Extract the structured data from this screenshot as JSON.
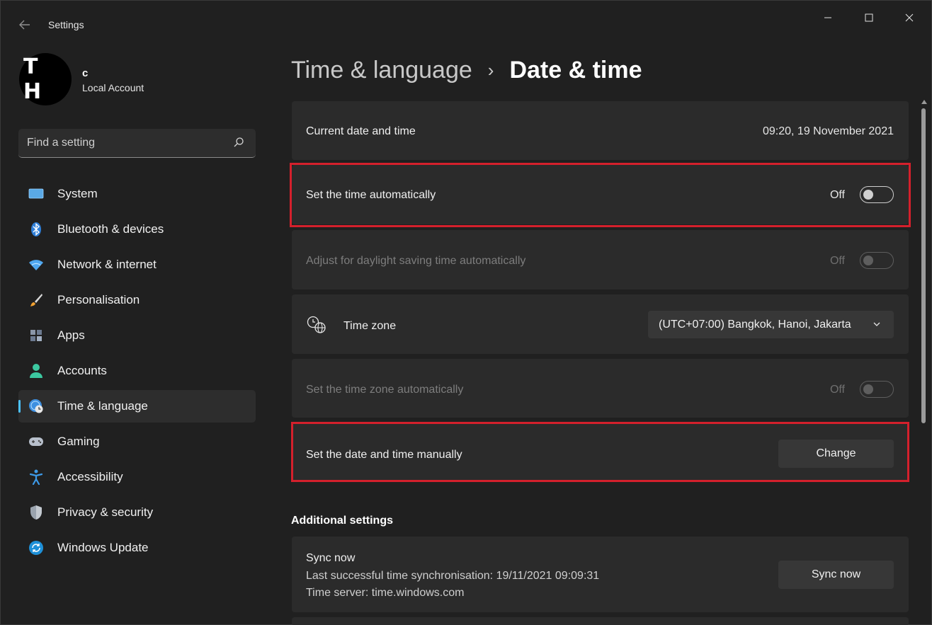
{
  "window": {
    "title": "Settings"
  },
  "profile": {
    "initials": "T H",
    "name": "c",
    "account_type": "Local Account"
  },
  "search": {
    "placeholder": "Find a setting"
  },
  "nav": {
    "items": [
      {
        "label": "System",
        "icon": "monitor-icon"
      },
      {
        "label": "Bluetooth & devices",
        "icon": "bluetooth-icon"
      },
      {
        "label": "Network & internet",
        "icon": "wifi-icon"
      },
      {
        "label": "Personalisation",
        "icon": "brush-icon"
      },
      {
        "label": "Apps",
        "icon": "apps-icon"
      },
      {
        "label": "Accounts",
        "icon": "person-icon"
      },
      {
        "label": "Time & language",
        "icon": "globe-clock-icon",
        "active": true
      },
      {
        "label": "Gaming",
        "icon": "gamepad-icon"
      },
      {
        "label": "Accessibility",
        "icon": "accessibility-icon"
      },
      {
        "label": "Privacy & security",
        "icon": "shield-icon"
      },
      {
        "label": "Windows Update",
        "icon": "update-icon"
      }
    ]
  },
  "header": {
    "parent": "Time & language",
    "separator": "›",
    "current": "Date & time"
  },
  "settings": {
    "current_datetime": {
      "label": "Current date and time",
      "value": "09:20, 19 November 2021"
    },
    "set_time_auto": {
      "label": "Set the time automatically",
      "state": "Off"
    },
    "daylight_saving": {
      "label": "Adjust for daylight saving time automatically",
      "state": "Off"
    },
    "time_zone": {
      "label": "Time zone",
      "value": "(UTC+07:00) Bangkok, Hanoi, Jakarta"
    },
    "time_zone_auto": {
      "label": "Set the time zone automatically",
      "state": "Off"
    },
    "manual": {
      "label": "Set the date and time manually",
      "button": "Change"
    }
  },
  "additional": {
    "title": "Additional settings",
    "sync": {
      "title": "Sync now",
      "last_sync": "Last successful time synchronisation: 19/11/2021 09:09:31",
      "server": "Time server: time.windows.com",
      "button": "Sync now"
    }
  },
  "colors": {
    "accent": "#4cc2ff",
    "highlight": "#d4202c",
    "background": "#202020",
    "card": "#2b2b2b"
  }
}
